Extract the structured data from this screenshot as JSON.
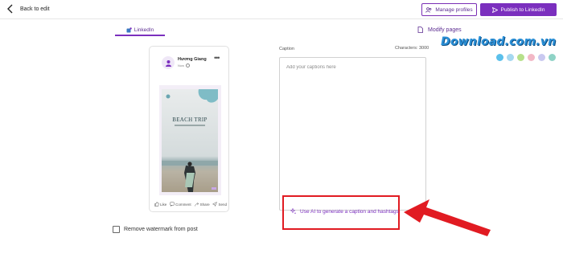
{
  "header": {
    "back_label": "Back to edit",
    "manage_profiles_label": "Manage profiles",
    "publish_label": "Publish to LinkedIn"
  },
  "tabs": {
    "active_label": "LinkedIn",
    "modify_pages_label": "Modify pages"
  },
  "watermark": {
    "logo_text": "Download.com.vn",
    "dot_colors": [
      "#5bc0eb",
      "#a5d8f0",
      "#b6e08a",
      "#f2b8c6",
      "#c9c9f0",
      "#8fd3c6"
    ]
  },
  "post_preview": {
    "author": "Hương Giang",
    "time": "Now",
    "image_title": "BEACH TRIP",
    "actions": [
      {
        "icon": "like-icon",
        "label": "Like"
      },
      {
        "icon": "comment-icon",
        "label": "Comment"
      },
      {
        "icon": "share-icon",
        "label": "Share"
      },
      {
        "icon": "send-icon",
        "label": "Send"
      }
    ]
  },
  "options": {
    "remove_watermark_label": "Remove watermark from post",
    "remove_watermark_checked": false
  },
  "caption": {
    "label": "Caption",
    "char_limit_text": "Characters: 3000",
    "placeholder": "Add your captions here",
    "value": "",
    "ai_link_label": "Use AI to generate a caption and hashtags"
  },
  "annotation": {
    "highlight_color": "#e11b22"
  },
  "colors": {
    "accent": "#7b2fbe",
    "accent_text": "#5c2d91"
  }
}
